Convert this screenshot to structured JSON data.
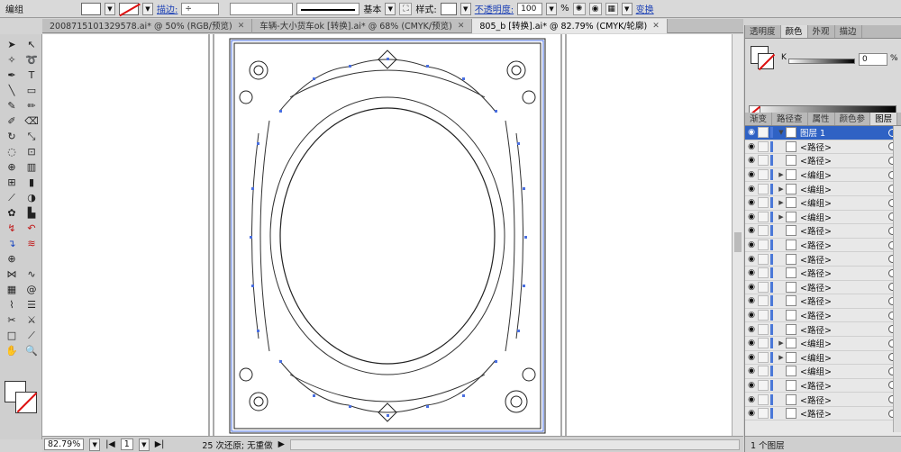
{
  "control_bar": {
    "selection_label": "编组",
    "stroke_label": "描边:",
    "stroke_style": "基本",
    "style_label": "样式:",
    "opacity_label": "不透明度:",
    "opacity_value": "100",
    "opacity_unit": "%",
    "transform_label": "变换"
  },
  "tabs": [
    {
      "label": "2008715101329578.ai* @ 50% (RGB/预览)",
      "close": "✕"
    },
    {
      "label": "车辆-大小货车ok [转换].ai* @ 68% (CMYK/预览)",
      "close": "✕"
    },
    {
      "label": "805_b [转换].ai* @ 82.79% (CMYK/轮廓)",
      "close": "✕"
    }
  ],
  "status_bar": {
    "zoom": "82.79%",
    "page": "1",
    "undo_text": "25 次还原; 无重做"
  },
  "color_panel": {
    "tabs": [
      "透明度",
      "颜色",
      "外观",
      "描边"
    ],
    "channel_label": "K",
    "channel_value": "0",
    "channel_unit": "%"
  },
  "layers_panel": {
    "tabs": [
      "渐变",
      "路径查",
      "属性",
      "颜色参",
      "图层"
    ],
    "rows": [
      {
        "name": "图层 1",
        "highlight": true,
        "expand": "▼"
      },
      {
        "name": "<路径>",
        "expand": ""
      },
      {
        "name": "<路径>",
        "expand": ""
      },
      {
        "name": "<编组>",
        "expand": "▶"
      },
      {
        "name": "<编组>",
        "expand": "▶"
      },
      {
        "name": "<编组>",
        "expand": "▶"
      },
      {
        "name": "<编组>",
        "expand": "▶"
      },
      {
        "name": "<路径>",
        "expand": ""
      },
      {
        "name": "<路径>",
        "expand": ""
      },
      {
        "name": "<路径>",
        "expand": ""
      },
      {
        "name": "<路径>",
        "expand": ""
      },
      {
        "name": "<路径>",
        "expand": ""
      },
      {
        "name": "<路径>",
        "expand": ""
      },
      {
        "name": "<路径>",
        "expand": ""
      },
      {
        "name": "<路径>",
        "expand": ""
      },
      {
        "name": "<编组>",
        "expand": "▶"
      },
      {
        "name": "<编组>",
        "expand": "▶"
      },
      {
        "name": "<编组>",
        "expand": ""
      },
      {
        "name": "<路径>",
        "expand": ""
      },
      {
        "name": "<路径>",
        "expand": ""
      },
      {
        "name": "<路径>",
        "expand": ""
      }
    ],
    "footer": "1 个图层"
  }
}
